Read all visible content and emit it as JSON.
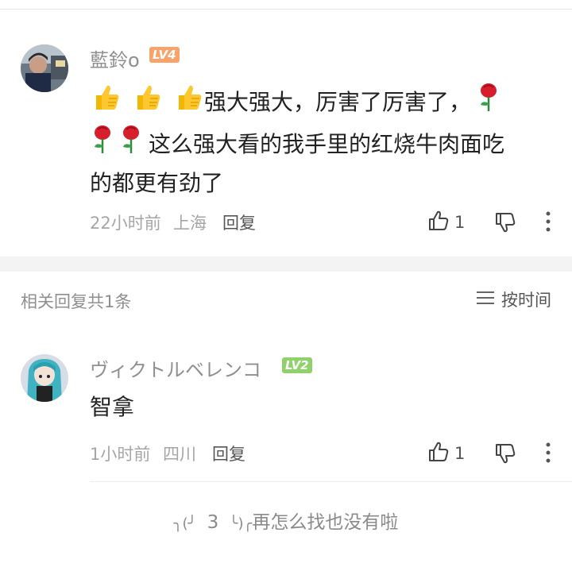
{
  "comment": {
    "username": "藍鈴o",
    "level": "LV4",
    "content_text": "强大强大，厉害了厉害了，",
    "content_line2": "这么强大看的我手里的红烧牛肉面吃",
    "content_line3": "的都更有劲了",
    "emojis": [
      "thumbs-up",
      "thumbs-up",
      "thumbs-up",
      "rose",
      "rose",
      "rose"
    ],
    "time": "22小时前",
    "location": "上海",
    "reply_label": "回复",
    "like_count": "1"
  },
  "replies_section": {
    "title": "相关回复共1条",
    "sort_label": "按时间"
  },
  "reply": {
    "username": "ヴィクトルベレンコ",
    "level": "LV2",
    "content": "智拿",
    "time": "1小时前",
    "location": "四川",
    "reply_label": "回复",
    "like_count": "1"
  },
  "footer": {
    "end_text": "再怎么找也没有啦",
    "kaomoji_left": "╮(╯",
    "kaomoji_mid": "3",
    "kaomoji_right": "╰)╭"
  },
  "colors": {
    "lv4": "#f7a36a",
    "lv2": "#8fd16a"
  }
}
